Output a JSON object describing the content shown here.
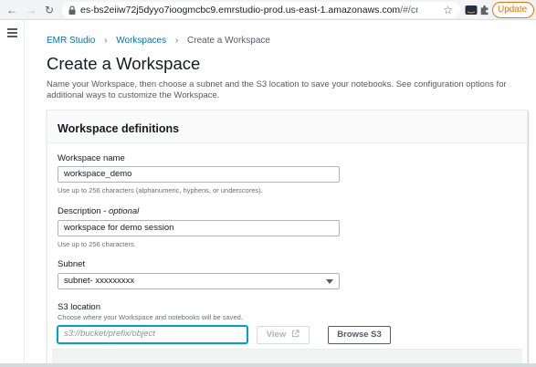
{
  "browser": {
    "url_host": "es-bs2eiiw72j5dyyo7ioogmcbc9.emrstudio-prod.us-east-1.amazonaws.com",
    "url_path": "/#/createW...",
    "update_label": "Update"
  },
  "breadcrumb": {
    "items": [
      "EMR Studio",
      "Workspaces"
    ],
    "current": "Create a Workspace"
  },
  "page": {
    "title": "Create a Workspace",
    "description": "Name your Workspace, then choose a subnet and the S3 location to save your notebooks. See configuration options for additional ways to customize the Workspace."
  },
  "panel": {
    "title": "Workspace definitions",
    "name": {
      "label": "Workspace name",
      "value": "workspace_demo",
      "hint": "Use up to 256 characters (alphanumeric, hyphens, or underscores)."
    },
    "description": {
      "label": "Description - ",
      "label_optional": "optional",
      "value": "workspace for demo session",
      "hint": "Use up to 256 characters."
    },
    "subnet": {
      "label": "Subnet",
      "value": "subnet- xxxxxxxxx"
    },
    "s3": {
      "label": "S3 location",
      "hint": "Choose where your Workspace and notebooks will be saved.",
      "placeholder": "s3://bucket/prefix/object",
      "view_label": "View",
      "browse_label": "Browse S3"
    }
  },
  "colors": {
    "link": "#0073bb",
    "focus": "#00a1c9",
    "update": "#e8710a"
  }
}
